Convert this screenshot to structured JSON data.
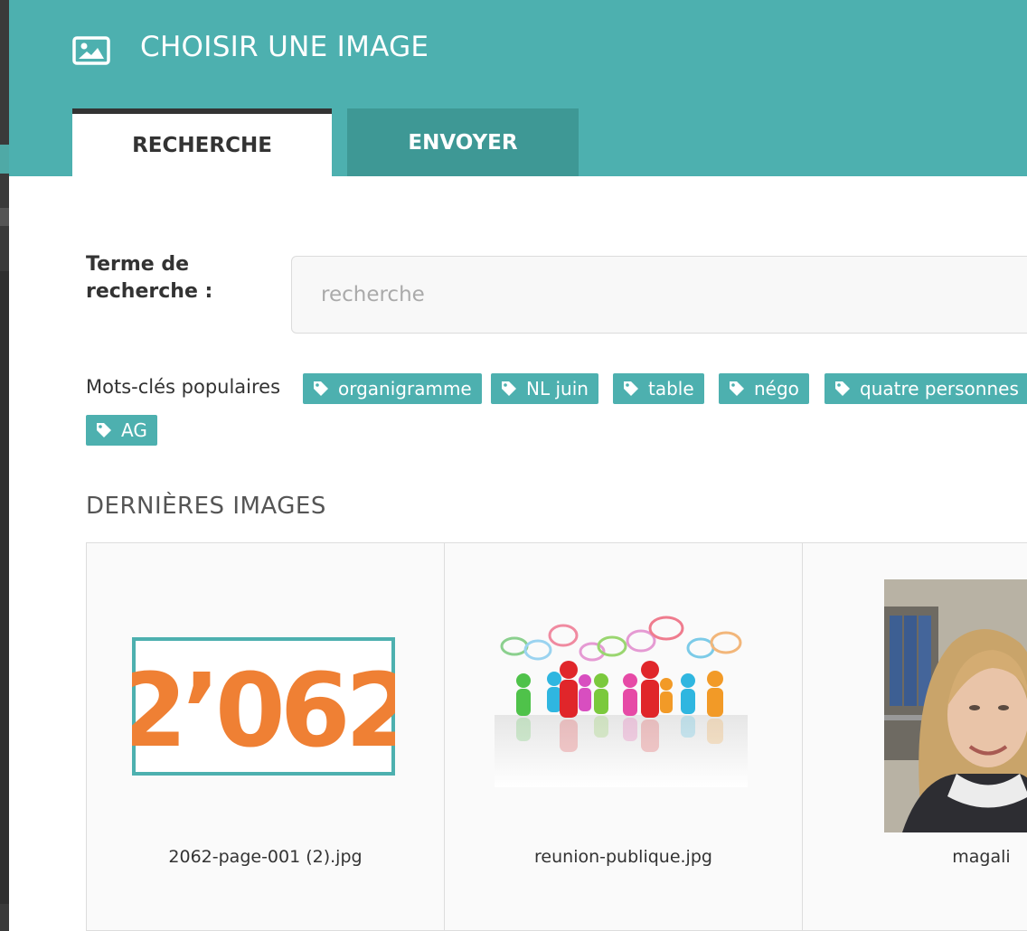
{
  "header": {
    "title": "CHOISIR UNE IMAGE",
    "icon": "image-icon",
    "color": "#4db0af"
  },
  "tabs": [
    {
      "label": "RECHERCHE",
      "active": true
    },
    {
      "label": "ENVOYER",
      "active": false
    }
  ],
  "search": {
    "label": "Terme de recherche :",
    "placeholder": "recherche",
    "value": ""
  },
  "popular": {
    "label": "Mots-clés populaires",
    "tags": [
      "organigramme",
      "NL juin",
      "table",
      "négo",
      "quatre personnes",
      "AG"
    ],
    "tag_icon": "tag-icon"
  },
  "latest": {
    "title": "DERNIÈRES IMAGES",
    "images": [
      {
        "caption": "2062-page-001 (2).jpg",
        "thumb_text": "2’062"
      },
      {
        "caption": "reunion-publique.jpg"
      },
      {
        "caption": "magali"
      }
    ]
  }
}
